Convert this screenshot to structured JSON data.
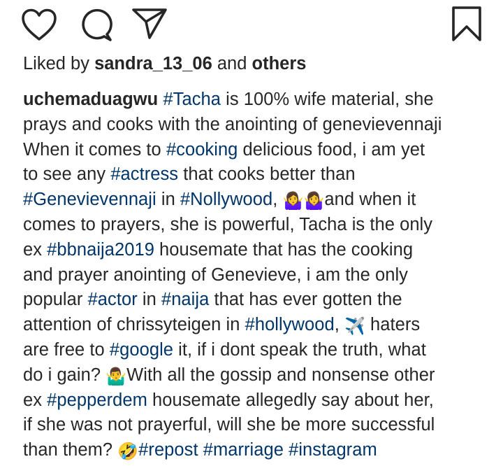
{
  "actions": {
    "like_icon": "heart-icon",
    "comment_icon": "comment-icon",
    "share_icon": "paper-plane-icon",
    "save_icon": "bookmark-icon"
  },
  "likes": {
    "prefix": "Liked by ",
    "user": "sandra_13_06",
    "middle": " and ",
    "others": "others"
  },
  "caption": {
    "username": "uchemaduagwu",
    "lines": [
      [
        {
          "t": "tag",
          "v": "#Tacha"
        },
        {
          "t": "text",
          "v": " is 100% wife material, she"
        }
      ],
      [
        {
          "t": "text",
          "v": "prays and cooks with the anointing of genevievennaji"
        }
      ],
      [
        {
          "t": "text",
          "v": "When it comes to "
        },
        {
          "t": "tag",
          "v": "#cooking"
        },
        {
          "t": "text",
          "v": " delicious food, i am yet"
        }
      ],
      [
        {
          "t": "text",
          "v": "to see any "
        },
        {
          "t": "tag",
          "v": "#actress"
        },
        {
          "t": "text",
          "v": " that cooks better than"
        }
      ],
      [
        {
          "t": "tag",
          "v": "#Genevievennaji"
        },
        {
          "t": "text",
          "v": " in "
        },
        {
          "t": "tag",
          "v": "#Nollywood"
        },
        {
          "t": "text",
          "v": ", "
        },
        {
          "t": "emoji",
          "v": "🤷‍♀️"
        },
        {
          "t": "emoji",
          "v": "🤷‍♀️"
        },
        {
          "t": "text",
          "v": "and when it"
        }
      ],
      [
        {
          "t": "text",
          "v": "comes to prayers, she is powerful, Tacha is the only"
        }
      ],
      [
        {
          "t": "text",
          "v": "ex "
        },
        {
          "t": "tag",
          "v": "#bbnaija2019"
        },
        {
          "t": "text",
          "v": " housemate that has the cooking"
        }
      ],
      [
        {
          "t": "text",
          "v": "and prayer anointing of Genevieve, i am the only"
        }
      ],
      [
        {
          "t": "text",
          "v": "popular "
        },
        {
          "t": "tag",
          "v": "#actor"
        },
        {
          "t": "text",
          "v": " in "
        },
        {
          "t": "tag",
          "v": "#naija"
        },
        {
          "t": "text",
          "v": " that has ever gotten the"
        }
      ],
      [
        {
          "t": "text",
          "v": "attention of chrissyteigen in "
        },
        {
          "t": "tag",
          "v": "#hollywood"
        },
        {
          "t": "text",
          "v": ", "
        },
        {
          "t": "emoji",
          "v": "✈️"
        },
        {
          "t": "text",
          "v": " haters"
        }
      ],
      [
        {
          "t": "text",
          "v": "are free to "
        },
        {
          "t": "tag",
          "v": "#google"
        },
        {
          "t": "text",
          "v": " it, if i dont speak the truth, what"
        }
      ],
      [
        {
          "t": "text",
          "v": "do i gain? "
        },
        {
          "t": "emoji",
          "v": "🤷‍♂️"
        },
        {
          "t": "text",
          "v": "With all the gossip and nonsense other"
        }
      ],
      [
        {
          "t": "text",
          "v": "ex "
        },
        {
          "t": "tag",
          "v": "#pepperdem"
        },
        {
          "t": "text",
          "v": " housemate allegedly say about her,"
        }
      ],
      [
        {
          "t": "text",
          "v": "if she was not prayerful, will she be more successful"
        }
      ],
      [
        {
          "t": "text",
          "v": "than them? "
        },
        {
          "t": "emoji",
          "v": "🤣"
        },
        {
          "t": "tag",
          "v": "#repost"
        },
        {
          "t": "text",
          "v": " "
        },
        {
          "t": "tag",
          "v": "#marriage"
        },
        {
          "t": "text",
          "v": " "
        },
        {
          "t": "tag",
          "v": "#instagram"
        }
      ]
    ]
  },
  "colors": {
    "text": "#262626",
    "hashtag": "#003569",
    "background": "#ffffff"
  }
}
